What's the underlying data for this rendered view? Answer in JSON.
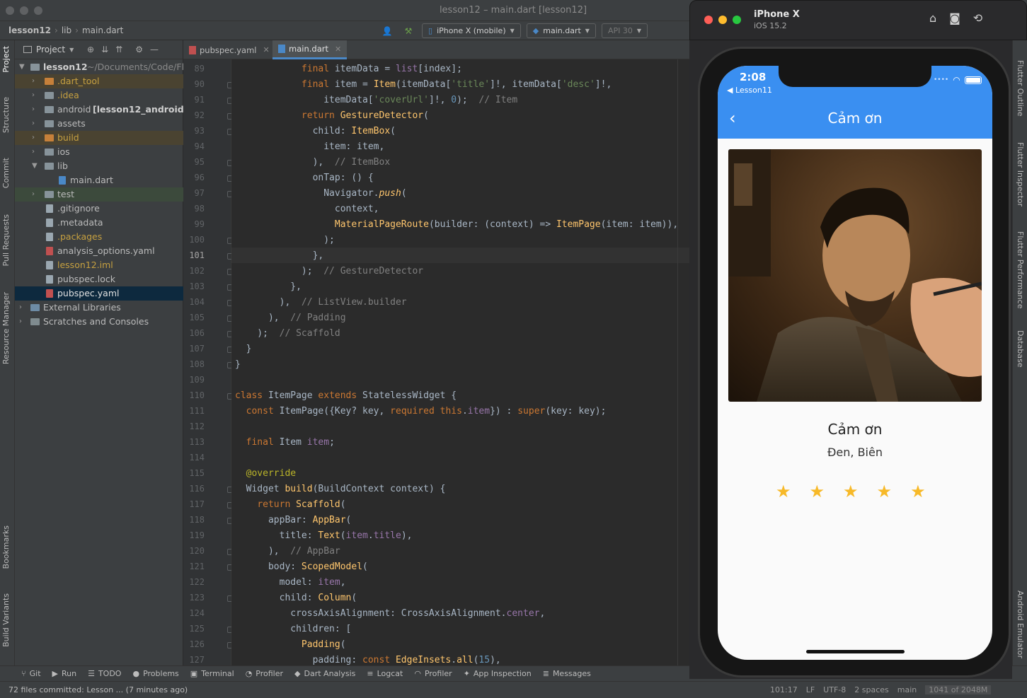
{
  "window": {
    "title": "lesson12 – main.dart [lesson12]"
  },
  "breadcrumb": [
    "lesson12",
    "lib",
    "main.dart"
  ],
  "toolbar": {
    "device": "iPhone X (mobile)",
    "run_config": "main.dart",
    "api": "API 30"
  },
  "left_tabs": [
    "Project",
    "Structure",
    "Commit",
    "Pull Requests",
    "Resource Manager",
    "Bookmarks",
    "Build Variants"
  ],
  "right_tabs": [
    "Flutter Outline",
    "Flutter Inspector",
    "Flutter Performance",
    "Database",
    "Android Emulator"
  ],
  "project": {
    "title": "Project",
    "root": "lesson12",
    "root_path": "~/Documents/Code/Fl",
    "items": [
      {
        "label": ".dart_tool"
      },
      {
        "label": ".idea"
      },
      {
        "label": "android",
        "extra": "[lesson12_android]"
      },
      {
        "label": "assets"
      },
      {
        "label": "build"
      },
      {
        "label": "ios"
      },
      {
        "label": "lib"
      },
      {
        "label": "main.dart"
      },
      {
        "label": "test"
      },
      {
        "label": ".gitignore"
      },
      {
        "label": ".metadata"
      },
      {
        "label": ".packages"
      },
      {
        "label": "analysis_options.yaml"
      },
      {
        "label": "lesson12.iml"
      },
      {
        "label": "pubspec.lock"
      },
      {
        "label": "pubspec.yaml"
      },
      {
        "label": "External Libraries"
      },
      {
        "label": "Scratches and Consoles"
      }
    ]
  },
  "editor": {
    "tabs": [
      "pubspec.yaml",
      "main.dart"
    ],
    "line_numbers": [
      "89",
      "90",
      "91",
      "92",
      "93",
      "94",
      "95",
      "96",
      "97",
      "98",
      "99",
      "100",
      "101",
      "102",
      "103",
      "104",
      "105",
      "106",
      "107",
      "108",
      "109",
      "110",
      "111",
      "112",
      "113",
      "114",
      "115",
      "116",
      "117",
      "118",
      "119",
      "120",
      "121",
      "122",
      "123",
      "124",
      "125",
      "126",
      "127"
    ],
    "current_line": "101"
  },
  "bottom_tools": [
    "Git",
    "Run",
    "TODO",
    "Problems",
    "Terminal",
    "Profiler",
    "Dart Analysis",
    "Logcat",
    "Profiler",
    "App Inspection",
    "Messages"
  ],
  "status": {
    "message": "72 files committed: Lesson ... (7 minutes ago)",
    "position": "101:17",
    "line_sep": "LF",
    "encoding": "UTF-8",
    "indent": "2 spaces",
    "branch": "main",
    "memory": "1041 of 2048M"
  },
  "simulator": {
    "device": "iPhone X",
    "os": "iOS 15.2"
  },
  "app": {
    "time": "2:08",
    "back_app": "◀ Lesson11",
    "appbar_title": "Cảm ơn",
    "item_title": "Cảm ơn",
    "item_desc": "Đen, Biên",
    "rating": 5,
    "rating_max": 5
  }
}
